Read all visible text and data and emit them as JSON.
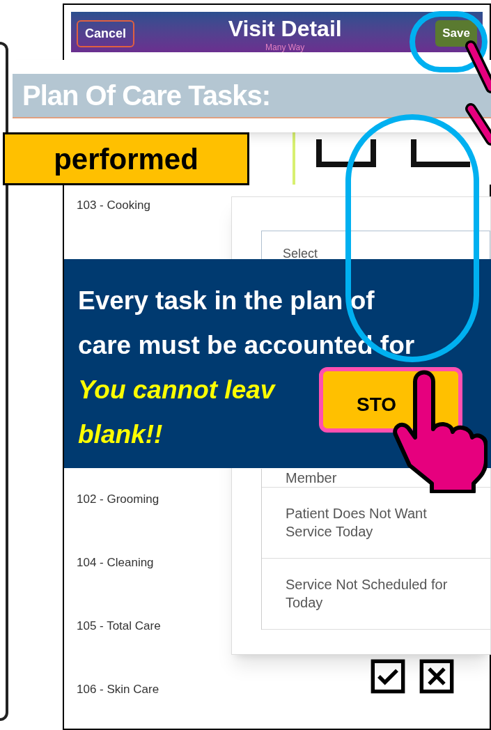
{
  "header": {
    "cancel": "Cancel",
    "title": "Visit Detail",
    "subtitle": "Many Way",
    "save": "Save"
  },
  "section_title": "Plan Of Care Tasks:",
  "callout": "performed",
  "tasks": [
    {
      "label": "103 - Cooking"
    },
    {
      "label": "102 - Grooming"
    },
    {
      "label": "104 - Cleaning"
    },
    {
      "label": "105 - Total Care"
    },
    {
      "label": "106 - Skin Care"
    }
  ],
  "dialog": {
    "placeholder": "Select",
    "options": [
      "Member",
      "Patient Does Not Want Service Today",
      "Service Not Scheduled for Today"
    ]
  },
  "banner": {
    "lines": [
      "Every task in the plan of",
      "care must be accounted for"
    ],
    "warning": [
      "You cannot leav",
      "blank!!"
    ]
  },
  "stop": "STO"
}
